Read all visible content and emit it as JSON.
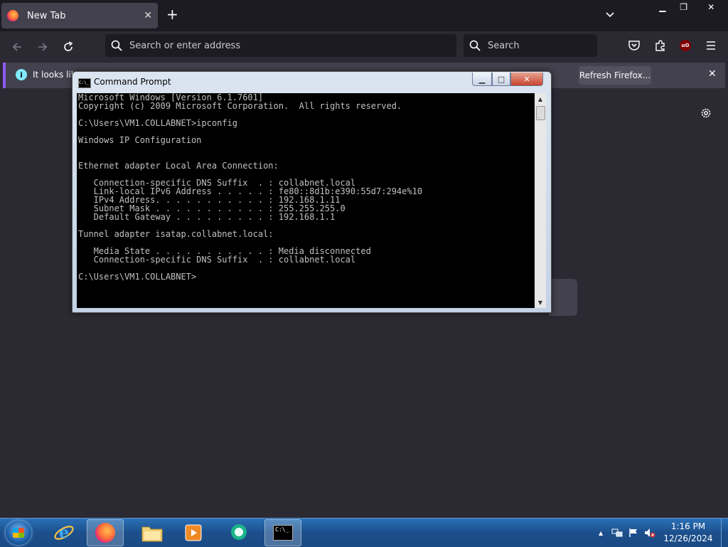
{
  "browser": {
    "tab": {
      "title": "New Tab",
      "close_glyph": "✕"
    },
    "new_tab_glyph": "+",
    "url_bar": {
      "placeholder": "Search or enter address",
      "value": ""
    },
    "search_bar": {
      "placeholder": "Search",
      "value": ""
    },
    "notification": {
      "message": "It looks lik",
      "button": "Refresh Firefox...",
      "close_glyph": "✕"
    },
    "colors": {
      "accent": "#9059ff",
      "toolbar": "#2b2a33",
      "tabstrip": "#1c1b22"
    }
  },
  "cmd": {
    "title": "Command Prompt",
    "lines": [
      "Microsoft Windows [Version 6.1.7601]",
      "Copyright (c) 2009 Microsoft Corporation.  All rights reserved.",
      "",
      "C:\\Users\\VM1.COLLABNET>ipconfig",
      "",
      "Windows IP Configuration",
      "",
      "",
      "Ethernet adapter Local Area Connection:",
      "",
      "   Connection-specific DNS Suffix  . : collabnet.local",
      "   Link-local IPv6 Address . . . . . : fe80::8d1b:e390:55d7:294e%10",
      "   IPv4 Address. . . . . . . . . . . : 192.168.1.11",
      "   Subnet Mask . . . . . . . . . . . : 255.255.255.0",
      "   Default Gateway . . . . . . . . . : 192.168.1.1",
      "",
      "Tunnel adapter isatap.collabnet.local:",
      "",
      "   Media State . . . . . . . . . . . : Media disconnected",
      "   Connection-specific DNS Suffix  . : collabnet.local",
      "",
      "C:\\Users\\VM1.COLLABNET>"
    ],
    "icon_text": "C:\\_"
  },
  "taskbar": {
    "apps": [
      "internet-explorer",
      "firefox",
      "windows-explorer",
      "media-player",
      "chat-app",
      "command-prompt"
    ],
    "active_app": "firefox",
    "clock": {
      "time": "1:16 PM",
      "date": "12/26/2024"
    },
    "tray_arrow": "▲"
  }
}
